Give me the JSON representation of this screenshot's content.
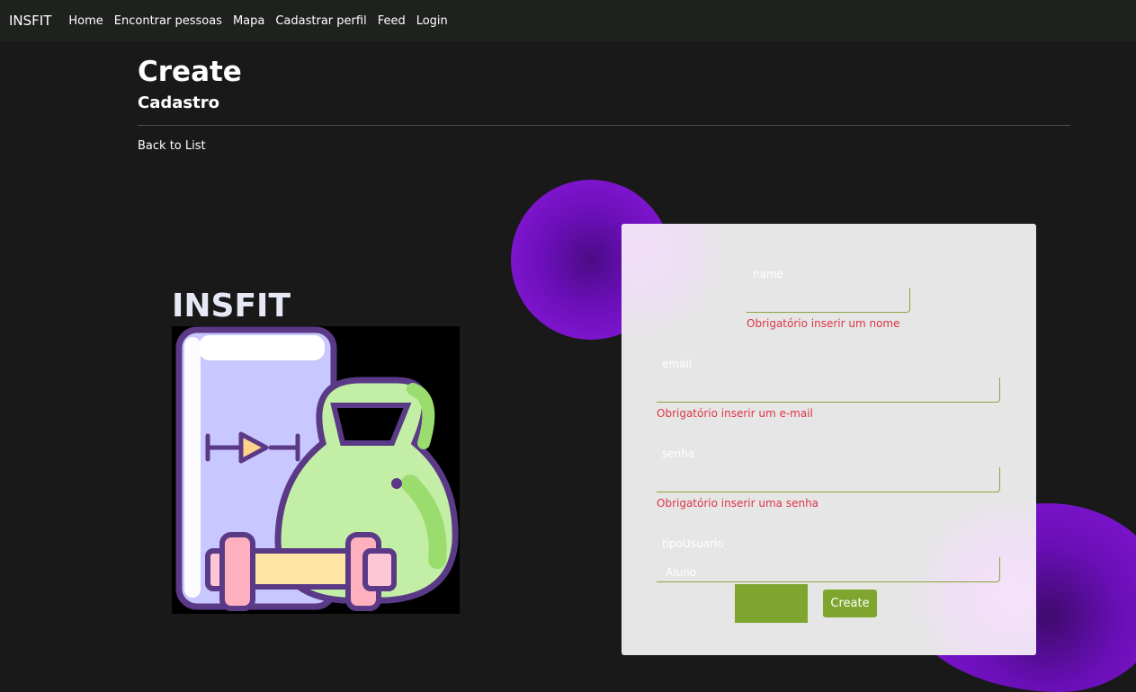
{
  "navbar": {
    "brand": "INSFIT",
    "links": [
      "Home",
      "Encontrar pessoas",
      "Mapa",
      "Cadastrar perfil",
      "Feed",
      "Login"
    ]
  },
  "page": {
    "title": "Create",
    "subtitle": "Cadastro",
    "back_link": "Back to List"
  },
  "hero": {
    "heading": "INSFIT"
  },
  "form": {
    "fields": [
      {
        "label": "name",
        "value": "",
        "error": "Obrigatório inserir um nome"
      },
      {
        "label": "email",
        "value": "",
        "error": "Obrigatório inserir um e-mail"
      },
      {
        "label": "senha",
        "value": "",
        "error": "Obrigatório inserir uma senha"
      },
      {
        "label": "tipoUsuario",
        "value": "Aluno",
        "error": ""
      }
    ],
    "create_label": "Create"
  },
  "colors": {
    "accent": "#7ea62e",
    "error": "#dc3545",
    "blob_purple": "#8f1ae0",
    "background": "#181918"
  }
}
